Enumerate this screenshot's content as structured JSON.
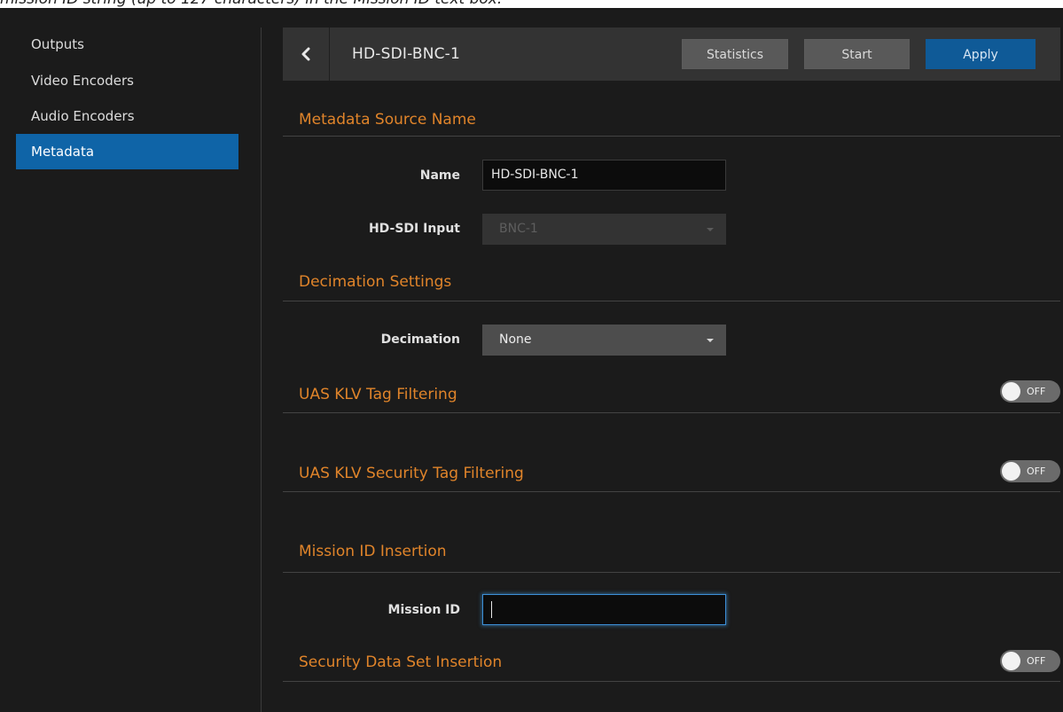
{
  "doc_caption": "mission ID string (up to 127 characters) in the Mission ID text box.",
  "sidebar": {
    "items": [
      {
        "label": "Outputs",
        "active": false
      },
      {
        "label": "Video Encoders",
        "active": false
      },
      {
        "label": "Audio Encoders",
        "active": false
      },
      {
        "label": "Metadata",
        "active": true
      }
    ]
  },
  "header": {
    "back_icon": "chevron-left-icon",
    "title": "HD-SDI-BNC-1",
    "statistics_label": "Statistics",
    "start_label": "Start",
    "apply_label": "Apply"
  },
  "sections": {
    "source": {
      "title": "Metadata Source Name",
      "name_label": "Name",
      "name_value": "HD-SDI-BNC-1",
      "hdsdi_label": "HD-SDI Input",
      "hdsdi_value": "BNC-1"
    },
    "decimation": {
      "title": "Decimation Settings",
      "label": "Decimation",
      "value": "None"
    },
    "uas_klv": {
      "title": "UAS KLV Tag Filtering",
      "toggle_label": "OFF"
    },
    "uas_klv_security": {
      "title": "UAS KLV Security Tag Filtering",
      "toggle_label": "OFF"
    },
    "mission": {
      "title": "Mission ID Insertion",
      "label": "Mission ID",
      "value": ""
    },
    "security_dataset": {
      "title": "Security Data Set Insertion",
      "toggle_label": "OFF"
    }
  },
  "colors": {
    "accent_orange": "#e0842a",
    "active_blue": "#0f64a7",
    "apply_blue": "#0f5a97",
    "focus_blue": "#3c8fd6"
  }
}
